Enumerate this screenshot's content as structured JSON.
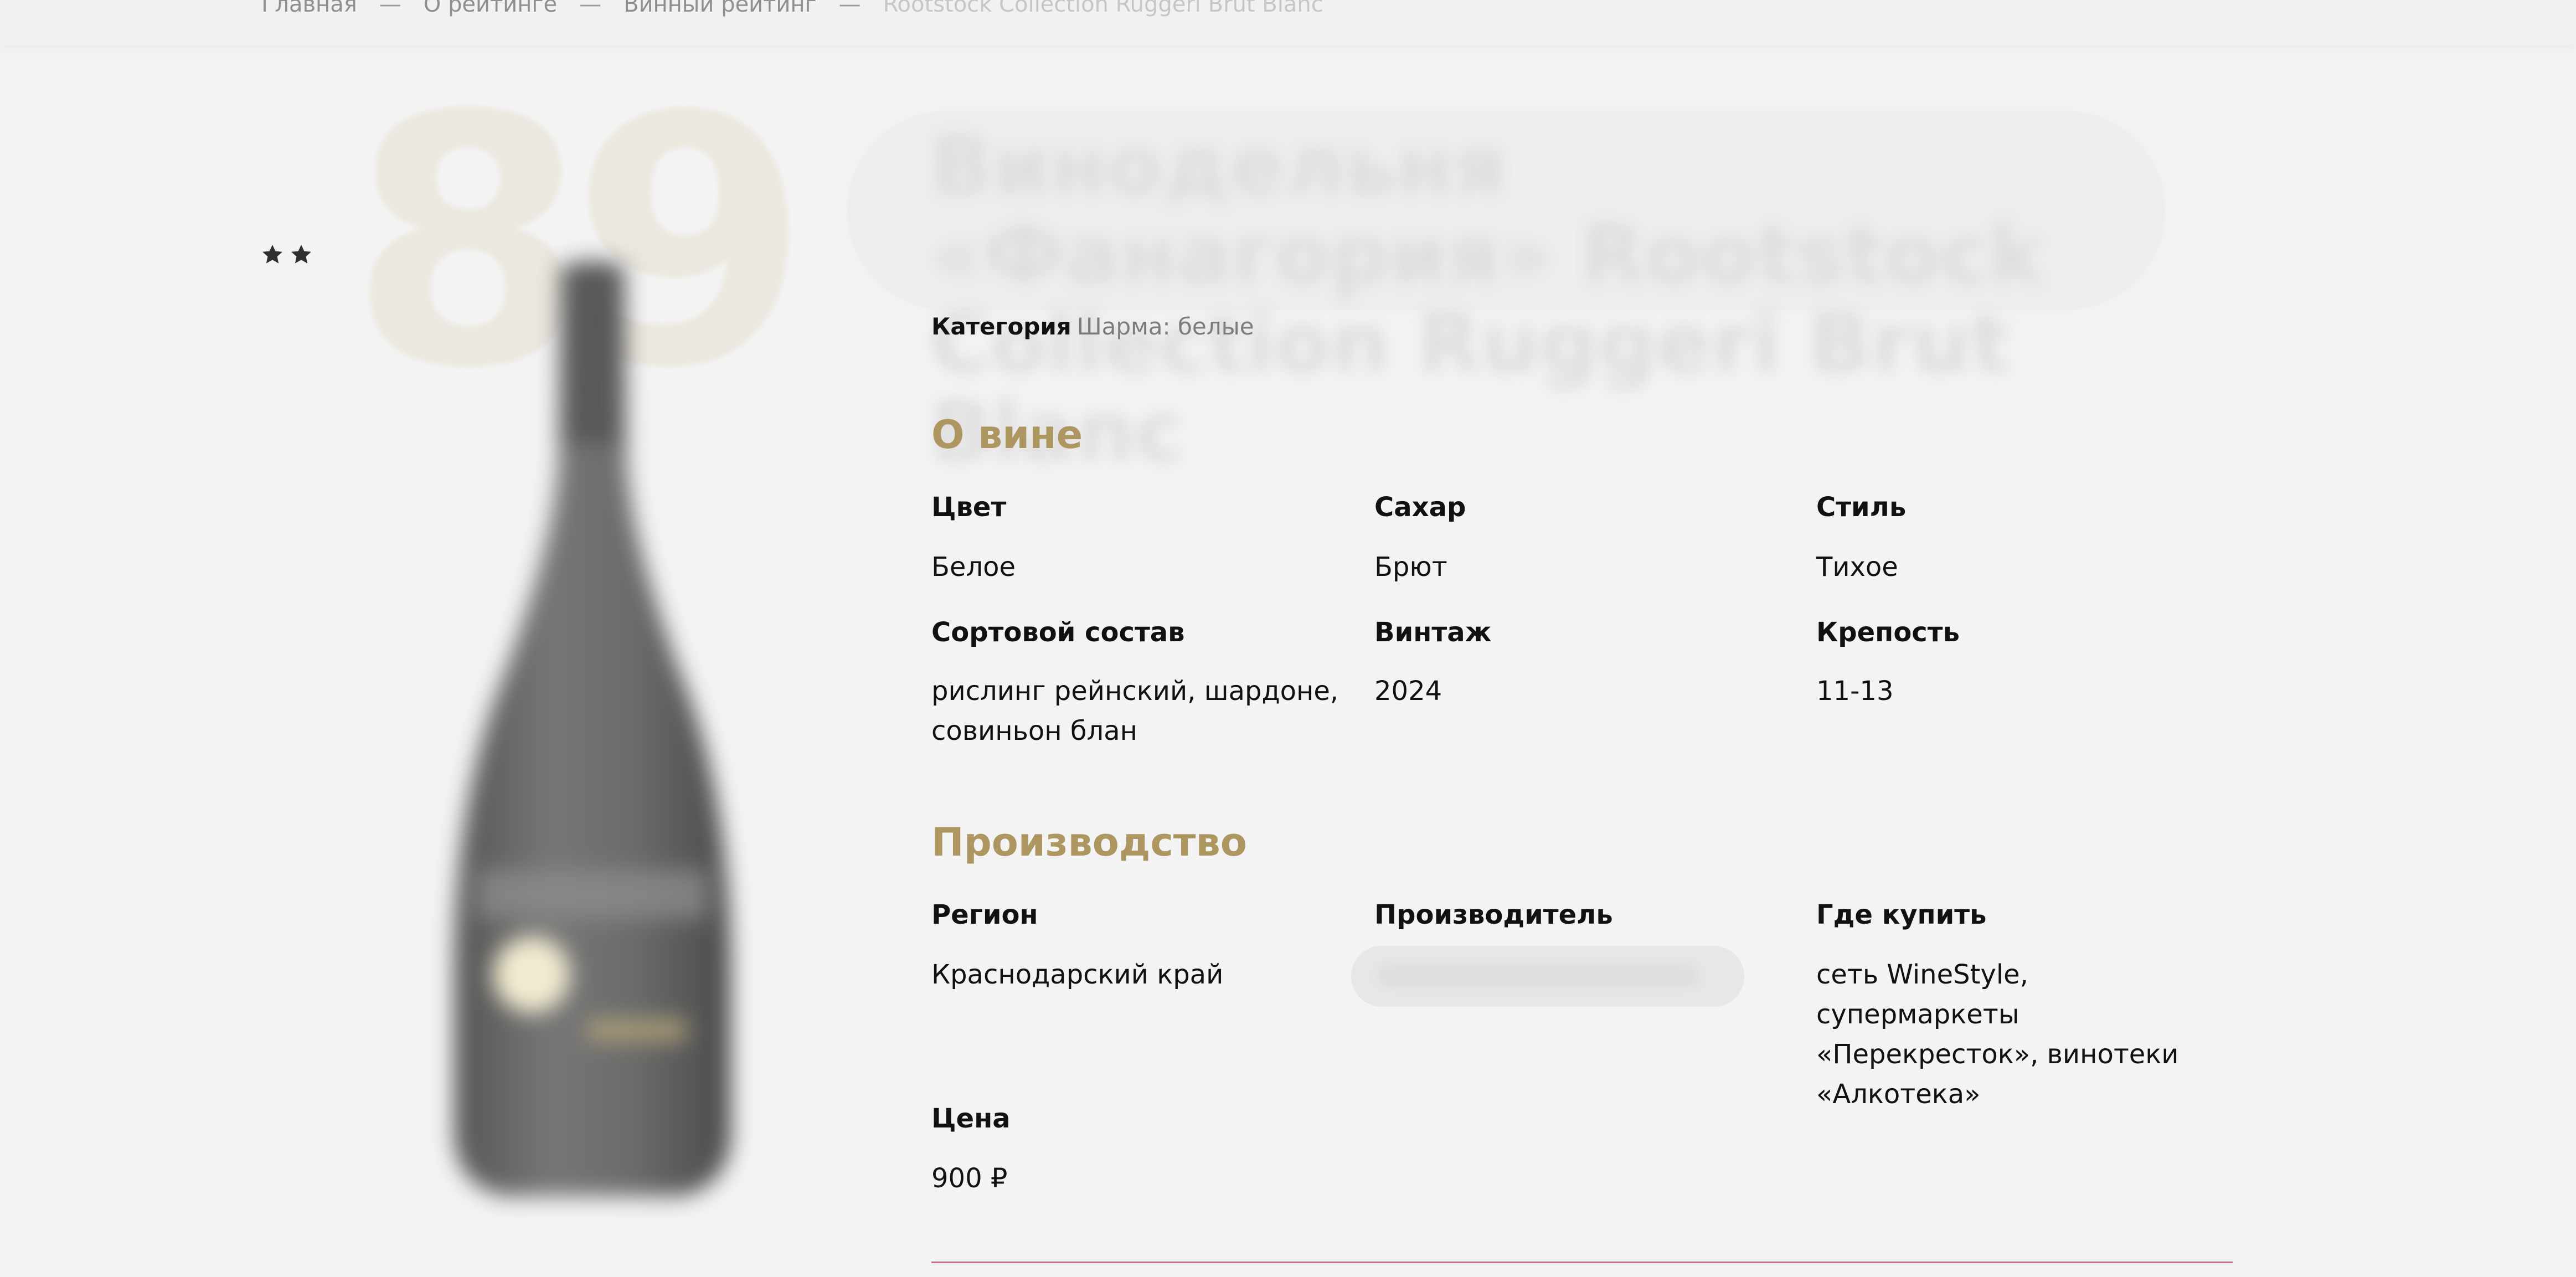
{
  "breadcrumb": {
    "items": [
      "Главная",
      "О рейтинге",
      "Винный рейтинг"
    ],
    "current": "Rootstock Collection Ruggeri Brut Blanc",
    "separator": "—"
  },
  "rating": {
    "stars": 2,
    "score": "89"
  },
  "product": {
    "title": "Винодельня «Фанагория» Rootstock Collection Ruggeri Brut Blanc",
    "category_label": "Категория",
    "category_value": "Шарма: белые"
  },
  "about": {
    "title": "О вине",
    "color_label": "Цвет",
    "color_value": "Белое",
    "sugar_label": "Сахар",
    "sugar_value": "Брют",
    "style_label": "Стиль",
    "style_value": "Тихое",
    "grapes_label": "Сортовой состав",
    "grapes_value": "рислинг рейнский, шардоне, совиньон блан",
    "vintage_label": "Винтаж",
    "vintage_value": "2024",
    "strength_label": "Крепость",
    "strength_value": "11-13"
  },
  "production": {
    "title": "Производство",
    "region_label": "Регион",
    "region_value": "Краснодарский край",
    "producer_label": "Производитель",
    "buy_label": "Где купить",
    "buy_value": "сеть WineStyle, супермаркеты «Перекресток», винотеки «Алкотека»",
    "price_label": "Цена",
    "price_value": "900 ₽"
  },
  "colors": {
    "accent_gold": "#ad9660",
    "divider_pink": "#c9708f",
    "score_bg": "#ece8e0",
    "background": "#f3f3f3"
  },
  "icons": {
    "star": "star-icon",
    "bottle": "wine-bottle-image"
  }
}
